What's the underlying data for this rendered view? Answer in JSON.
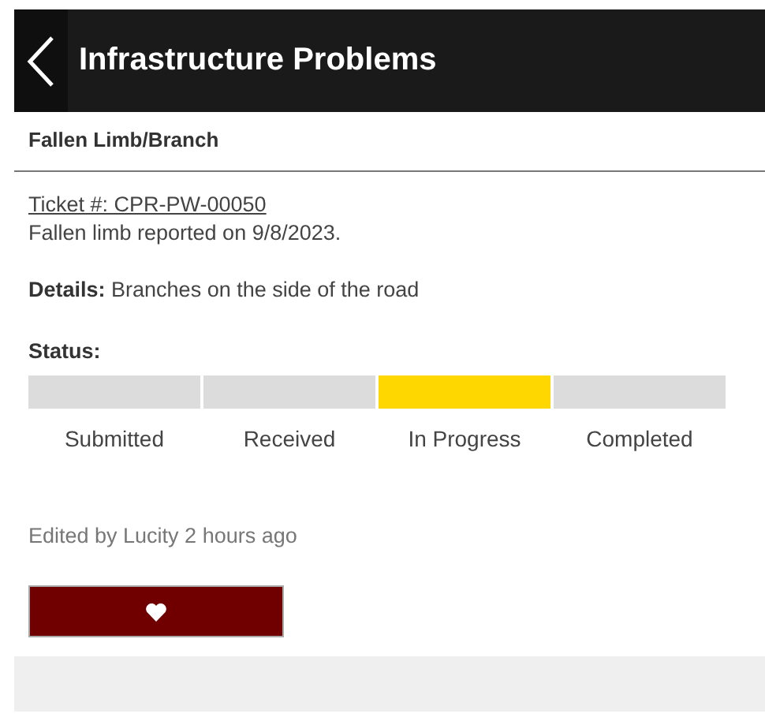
{
  "header": {
    "title": "Infrastructure Problems"
  },
  "problem": {
    "title": "Fallen Limb/Branch",
    "ticket_link": "Ticket #: CPR-PW-00050",
    "summary": "Fallen limb reported on 9/8/2023.",
    "details": "**Details:** Branches on the side of the road"
  },
  "status": {
    "label": "Status:",
    "steps": [
      {
        "label": "Submitted",
        "selected": false
      },
      {
        "label": "Received",
        "selected": false
      },
      {
        "label": "In Progress",
        "selected": true
      },
      {
        "label": "Completed",
        "selected": false
      }
    ]
  },
  "edited": "Edited by Lucity 2 hours ago",
  "like_button": {
    "kind": "heart"
  }
}
